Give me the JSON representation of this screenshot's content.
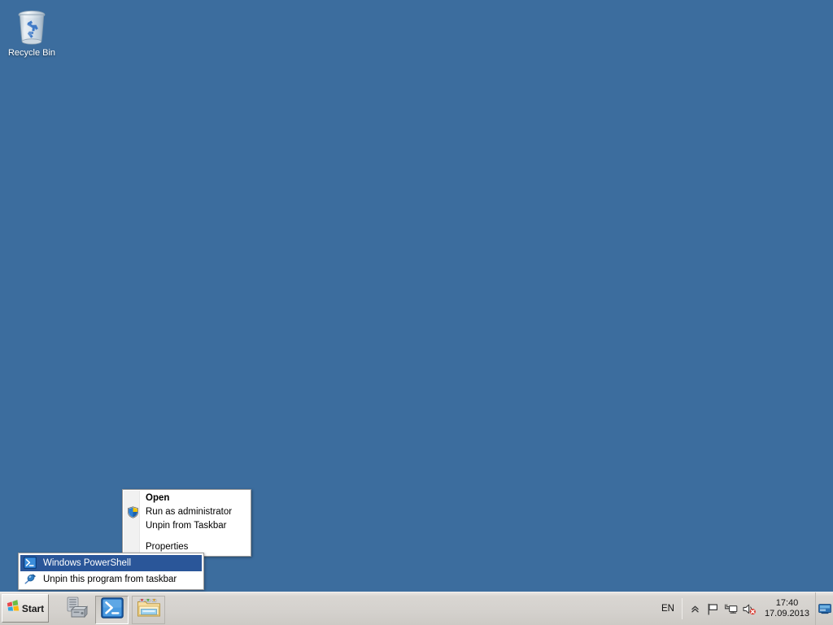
{
  "desktop": {
    "background_color": "#3c6d9e",
    "icons": [
      {
        "name": "recycle-bin",
        "label": "Recycle Bin",
        "icon": "recycle-bin-icon"
      }
    ]
  },
  "context_menu": {
    "items": [
      {
        "label": "Open",
        "icon": null,
        "bold": true,
        "separator_after": false
      },
      {
        "label": "Run as administrator",
        "icon": "uac-shield-icon",
        "bold": false,
        "separator_after": false
      },
      {
        "label": "Unpin from Taskbar",
        "icon": null,
        "bold": false,
        "separator_after": true
      },
      {
        "label": "Properties",
        "icon": null,
        "bold": false,
        "separator_after": false
      }
    ]
  },
  "jump_list": {
    "items": [
      {
        "label": "Windows PowerShell",
        "icon": "powershell-icon",
        "selected": true
      },
      {
        "label": "Unpin this program from taskbar",
        "icon": "pin-icon",
        "selected": false
      }
    ],
    "highlight_color": "#2a5699"
  },
  "taskbar": {
    "start_label": "Start",
    "start_icon": "windows-flag-icon",
    "buttons": [
      {
        "name": "server-manager",
        "icon": "server-manager-icon",
        "active": false,
        "outlined": false
      },
      {
        "name": "windows-powershell",
        "icon": "powershell-icon",
        "active": true,
        "outlined": false
      },
      {
        "name": "file-explorer",
        "icon": "file-explorer-icon",
        "active": false,
        "outlined": true
      }
    ],
    "tray": {
      "language": "EN",
      "icons": [
        {
          "name": "show-hidden-icons",
          "icon": "chevron-up-icon"
        },
        {
          "name": "action-center",
          "icon": "flag-icon"
        },
        {
          "name": "network",
          "icon": "network-icon"
        },
        {
          "name": "volume-muted",
          "icon": "speaker-muted-icon"
        }
      ],
      "clock": {
        "time": "17:40",
        "date": "17.09.2013"
      },
      "show_desktop": "show-desktop-button"
    }
  }
}
